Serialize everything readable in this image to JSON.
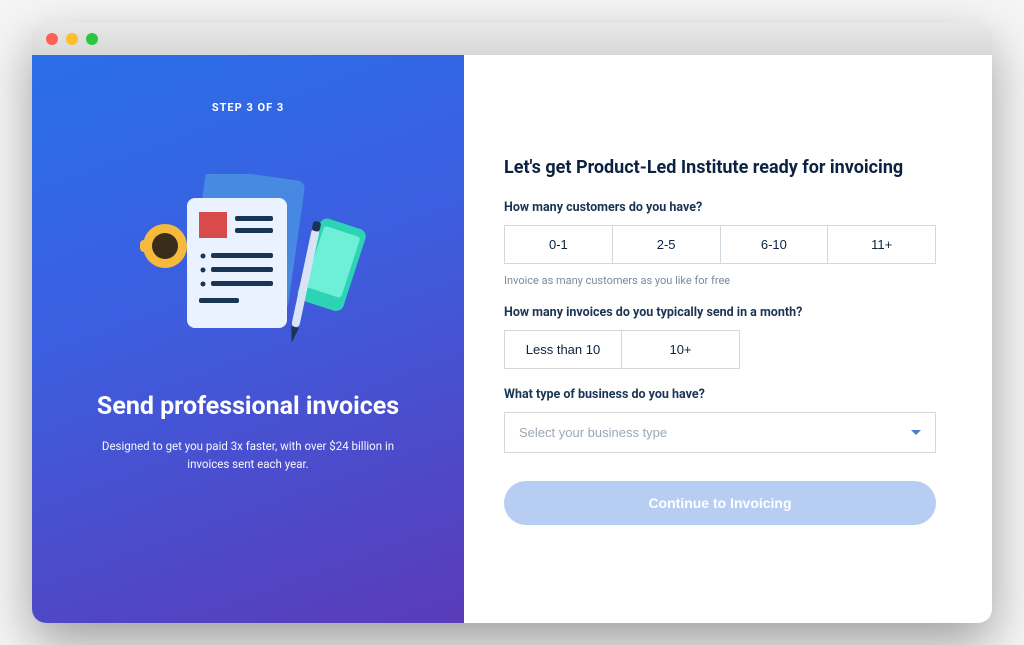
{
  "left": {
    "step_indicator": "STEP 3 OF 3",
    "heading": "Send professional invoices",
    "subtext": "Designed to get you paid 3x faster, with over $24 billion in invoices sent each year."
  },
  "right": {
    "heading": "Let's get Product-Led Institute ready for invoicing",
    "questions": {
      "customers": {
        "label": "How many customers do you have?",
        "options": [
          "0-1",
          "2-5",
          "6-10",
          "11+"
        ],
        "helper": "Invoice as many customers as you like for free"
      },
      "invoices": {
        "label": "How many invoices do you typically send in a month?",
        "options": [
          "Less than 10",
          "10+"
        ]
      },
      "business_type": {
        "label": "What type of business do you have?",
        "placeholder": "Select your business type"
      }
    },
    "cta": "Continue to Invoicing"
  }
}
